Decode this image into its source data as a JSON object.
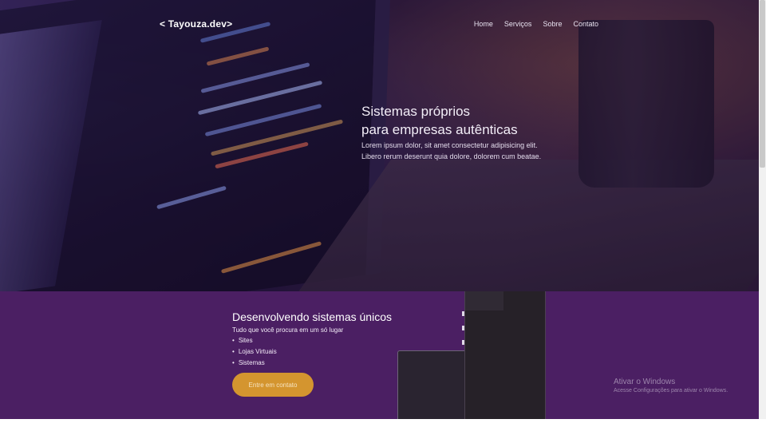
{
  "nav": {
    "brand": "< Tayouza.dev>",
    "links": [
      "Home",
      "Serviços",
      "Sobre",
      "Contato"
    ]
  },
  "hero": {
    "title_line1": "Sistemas próprios",
    "title_line2": "para empresas autênticas",
    "subtitle_line1": "Lorem ipsum dolor, sit amet consectetur adipisicing elit.",
    "subtitle_line2": "Libero rerum deserunt quia dolore, dolorem cum beatae."
  },
  "section": {
    "title": "Desenvolvendo sistemas únicos",
    "subtitle": "Tudo que você procura em um só lugar",
    "items": [
      "Sites",
      "Lojas Virtuais",
      "Sistemas"
    ],
    "cta_label": "Entre em contato"
  },
  "watermark": {
    "title": "Ativar o Windows",
    "subtitle": "Acesse Configurações para ativar o Windows."
  },
  "colors": {
    "section_bg": "#4b1f63",
    "cta_bg": "#d4952f",
    "hero_overlay": "#26123c"
  }
}
